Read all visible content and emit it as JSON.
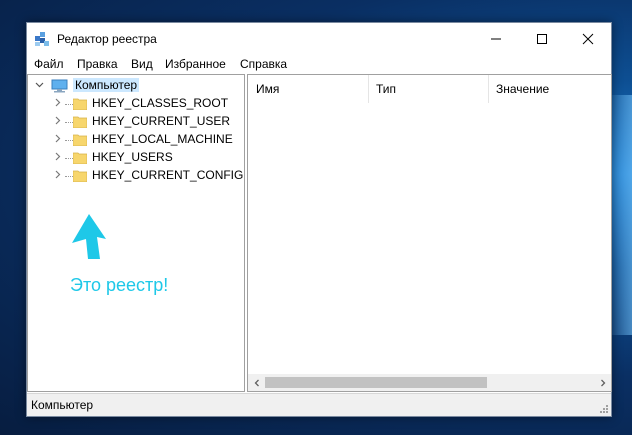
{
  "window": {
    "title": "Редактор реестра",
    "controls": {
      "minimize": "—",
      "maximize": "☐",
      "close": "✕"
    }
  },
  "menu": [
    "Файл",
    "Правка",
    "Вид",
    "Избранное",
    "Справка"
  ],
  "tree": {
    "root": {
      "label": "Компьютер",
      "icon": "computer-icon",
      "expanded": true
    },
    "children": [
      {
        "label": "HKEY_CLASSES_ROOT",
        "icon": "folder-icon"
      },
      {
        "label": "HKEY_CURRENT_USER",
        "icon": "folder-icon"
      },
      {
        "label": "HKEY_LOCAL_MACHINE",
        "icon": "folder-icon"
      },
      {
        "label": "HKEY_USERS",
        "icon": "folder-icon"
      },
      {
        "label": "HKEY_CURRENT_CONFIG",
        "icon": "folder-icon"
      }
    ]
  },
  "annotation": {
    "text": "Это реестр!",
    "color": "#1ec8e8",
    "icon": "arrow-up-icon"
  },
  "list": {
    "columns": [
      "Имя",
      "Тип",
      "Значение"
    ]
  },
  "status": {
    "path": "Компьютер"
  },
  "colors": {
    "folder": "#f7d66d",
    "annotation": "#1ec8e8",
    "desktop": "#0a2f63"
  }
}
